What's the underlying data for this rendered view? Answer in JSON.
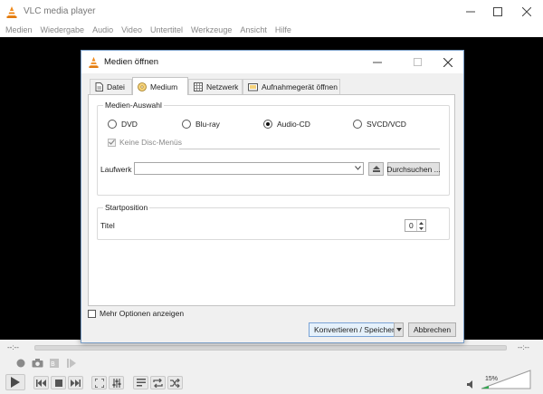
{
  "window": {
    "title": "VLC media player",
    "minimize_icon": "minimize-icon",
    "maximize_icon": "maximize-icon",
    "close_icon": "close-icon"
  },
  "menubar": [
    "Medien",
    "Wiedergabe",
    "Audio",
    "Video",
    "Untertitel",
    "Werkzeuge",
    "Ansicht",
    "Hilfe"
  ],
  "dialog": {
    "title": "Medien öffnen",
    "tabs": [
      {
        "label": "Datei",
        "icon": "file-icon",
        "active": false
      },
      {
        "label": "Medium",
        "icon": "disc-icon",
        "active": true
      },
      {
        "label": "Netzwerk",
        "icon": "network-icon",
        "active": false
      },
      {
        "label": "Aufnahmegerät öffnen",
        "icon": "capture-device-icon",
        "active": false
      }
    ],
    "media_selection": {
      "legend": "Medien-Auswahl",
      "options": [
        {
          "label": "DVD",
          "selected": false
        },
        {
          "label": "Blu-ray",
          "selected": false
        },
        {
          "label": "Audio-CD",
          "selected": true
        },
        {
          "label": "SVCD/VCD",
          "selected": false
        }
      ],
      "no_disc_menus": {
        "label": "Keine Disc-Menüs",
        "checked": true,
        "enabled": false
      },
      "drive_label": "Laufwerk",
      "drive_value": "",
      "browse_label": "Durchsuchen ..."
    },
    "start_position": {
      "legend": "Startposition",
      "title_label": "Titel",
      "title_value": "0"
    },
    "more_options_label": "Mehr Optionen anzeigen",
    "convert_label": "Konvertieren / Speichern",
    "cancel_label": "Abbrechen"
  },
  "player": {
    "time_elapsed": "--:--",
    "time_total": "--:--",
    "volume": "15%",
    "volume_level": 0.15
  },
  "colors": {
    "video_bg": "#000000",
    "vlc_orange": "#f08a1c",
    "dialog_border": "#7a9ec7",
    "volume_green": "#2fa84f"
  }
}
